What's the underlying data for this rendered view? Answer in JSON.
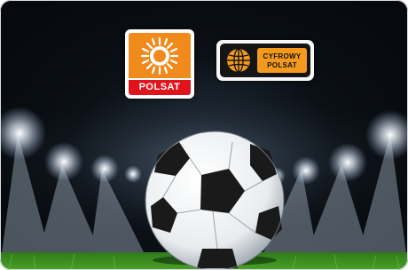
{
  "logos": {
    "polsat": {
      "name": "POLSAT",
      "icon": "sun-icon",
      "colors": {
        "sun": "#f08a1c",
        "bar": "#e2141b"
      }
    },
    "cyfrowy_polsat": {
      "line1": "CYFROWY",
      "line2": "POLSAT",
      "icon": "globe-icon",
      "colors": {
        "accent": "#f39a1e",
        "body": "#151515"
      }
    }
  },
  "scene": {
    "subject": "soccer-ball",
    "background": "stadium-floodlights"
  }
}
